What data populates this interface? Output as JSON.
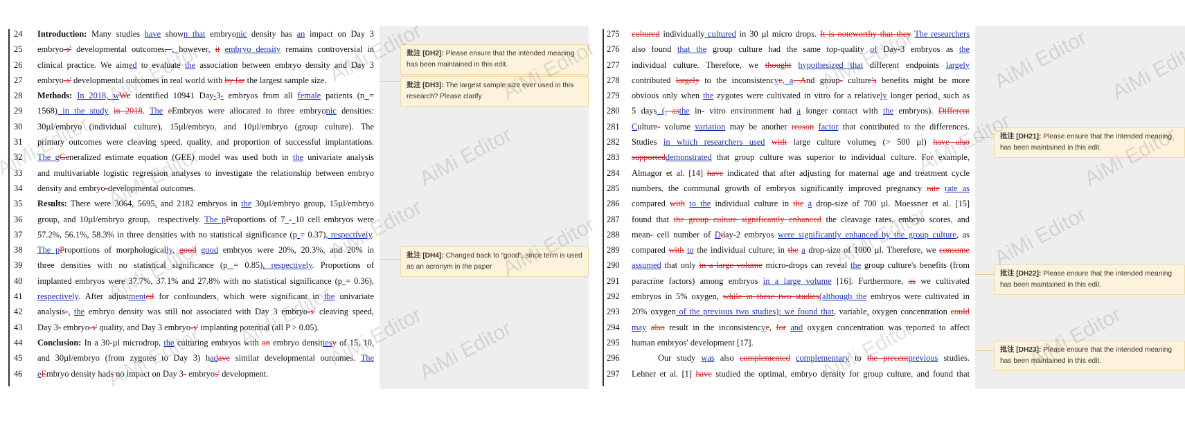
{
  "watermark": "AiMi Editor",
  "left_page": {
    "lines": [
      {
        "n": "24",
        "html": "<b>Introduction:</b> Many studies <span class=\"ins\">have</span> show<span class=\"ins\">n that</span> embryo<span class=\"ins\">nic</span> density has <span class=\"ins\">an</span> impact on Day 3"
      },
      {
        "n": "25",
        "html": "embryo<span class=\"del\">-s'</span> developmental outcomes<span class=\"del\">, </span><span class=\"ins\">; </span>however<span class=\"ins\">,</span> <span class=\"del\">it</span> <span class=\"ins\">embryo density</span> remains controversial in"
      },
      {
        "n": "26",
        "html": "clinical practice. We aim<span class=\"ins\">ed</span> to evaluate <span class=\"ins\">the</span> association between embryo density and Day 3"
      },
      {
        "n": "27",
        "html": "embryo<span class=\"del\">-s'</span> developmental outcomes in real world with <span class=\"del\">by far</span> the largest sample size.",
        "last": true
      },
      {
        "n": "28",
        "html": "<b>Methods:</b> <span class=\"ins\">In 2018, w</span><span class=\"del\">W</span>e identified 10941 Day<span class=\"ins\">-</span>3<span class=\"ins\">-</span> embryos from all <span class=\"ins\">female</span> patients (n<span class=\"ins\"> </span>="
      },
      {
        "n": "29",
        "html": "1568)<span class=\"ins\"> in the study</span> <span class=\"del\">in 2018</span>. <span class=\"ins\">The</span> <span class=\"del\">e</span>Embryos were allocated to three embryo<span class=\"ins\">nic</span> densities:"
      },
      {
        "n": "30",
        "html": "30µl/embryo (individual culture), 15µl/embryo<span class=\"ins\">,</span> and 10µl/embryo (group culture). The"
      },
      {
        "n": "31",
        "html": "primary outcomes were cleaving speed, quality<span class=\"ins\">,</span> and proportion of successful implantations."
      },
      {
        "n": "32",
        "html": "<span class=\"ins\">The g</span><span class=\"del\">G</span>eneralized estimate equation (GEE) model was used both in <span class=\"ins\">the</span> univariate analysis"
      },
      {
        "n": "33",
        "html": "and multivariable logistic regression analyses to investigate the relationship between embryo"
      },
      {
        "n": "34",
        "html": "density and embryo<span class=\"del\">-</span>developmental outcomes.",
        "last": true
      },
      {
        "n": "35",
        "html": "<b>Results:</b> There were 3064, 5695<span class=\"ins\">,</span> and 2182 embryos in <span class=\"ins\">the</span> 30µl/embryo group, 15µl/embryo"
      },
      {
        "n": "36",
        "html": "group<span class=\"ins\">,</span> and 10µl/embryo group, &nbsp;respectively. <span class=\"ins\">The p</span><span class=\"del\">P</span>roportions of 7<span class=\"ins\"> </span>-<span class=\"ins\"> </span>10 cell embryos were"
      },
      {
        "n": "37",
        "html": "57.2%, 56.1%, 58.3% in three densities with no statistical significance (p<span class=\"ins\"> </span>= 0.37)<span class=\"ins\">, respectively</span>."
      },
      {
        "n": "38",
        "html": "<span class=\"ins\">The p</span><span class=\"del\">P</span>roportions of morphological<span class=\"ins\">ly,</span> <span class=\"del\">good</span> <span class=\"ins\">good</span> embryos were 20%, 20.3%<span class=\"ins\">,</span> and 20% in"
      },
      {
        "n": "39",
        "html": "three densities with no statistical significance (p<span class=\"ins\"> </span>= 0.85)<span class=\"ins\">, respectively</span>. Proportions of"
      },
      {
        "n": "40",
        "html": "implanted embryos were 37.7%, 37.1% and 27.8% with no statistical significance (p<span class=\"ins\"> </span>= 0.36)<span class=\"ins\">,</span>"
      },
      {
        "n": "41",
        "html": "<span class=\"ins\">respectively</span>. After adjust<span class=\"ins\">ment</span><span class=\"del\">ed</span> for confounders<span class=\"ins\">,</span> which were significant in <span class=\"ins\">the</span> univariate"
      },
      {
        "n": "42",
        "html": "analysis<span class=\"del\">-</span><span class=\"ins\">,</span> <span class=\"ins\">the</span> embryo density was still not associated with Day 3 embryo<span class=\"del\">-s'</span> cleaving speed,"
      },
      {
        "n": "43",
        "html": "Day 3<span class=\"del\">-</span> embryo<span class=\"del\">-s'</span> quality<span class=\"ins\">,</span> and Day 3 embryo<span class=\"del\">-s'</span> implanting potential (all P &gt; 0.05).",
        "last": true
      },
      {
        "n": "44",
        "html": "<b>Conclusion:</b> In a 30-µl microdrop, <span class=\"ins\">the</span> culturing embryos with <span class=\"del\">an</span> embryo densit<span class=\"ins\">ies</span><span class=\"del\">y</span> of 15, 10<span class=\"ins\">,</span>"
      },
      {
        "n": "45",
        "html": "and 30µl/embryo (from zygotes to Day 3) h<span class=\"ins\">ad</span><span class=\"del\">ave</span> similar developmental outcomes. <span class=\"ins\">The</span>"
      },
      {
        "n": "46",
        "html": "<span class=\"ins\">e</span><span class=\"del\">E</span>mbryo density had<span class=\"del\">s</span> no impact on Day 3<span class=\"del\">-</span> embryo<span class=\"del\">s'</span> development.",
        "last": true
      }
    ]
  },
  "right_page": {
    "lines": [
      {
        "n": "275",
        "html": "<span class=\"del\">cultured</span> individually<span class=\"ins\"> cultured</span> in 30 µl micro drops. <span class=\"del\">It is noteworthy that they</span> <span class=\"ins\">The researchers</span>"
      },
      {
        "n": "276",
        "html": "also found <span class=\"ins\">that the</span> group culture had the same top-quality <span class=\"ins\">of</span> Day<span class=\"del\">-</span>3 embryos as <span class=\"ins\">the</span>"
      },
      {
        "n": "277",
        "html": "individual culture. Therefore, we <span class=\"del\">thought</span> <span class=\"ins\">hypothesized that</span> different endpoints <span class=\"ins\">largely</span>"
      },
      {
        "n": "278",
        "html": "contributed <span class=\"del\">largely</span> to the inconsistenc<span class=\"ins\">y</span><span class=\"del\">e</span><span class=\"ins\">, a</span><span class=\"del\">. A</span>nd group<span class=\"del\">-</span> culture<span class=\"del\">'s</span> benefits might be more"
      },
      {
        "n": "279",
        "html": "obvious only when <span class=\"ins\">the</span> zygotes were cultivated in vitro for a relative<span class=\"ins\">ly</span> longer period<span class=\"ins\">,</span> such as"
      },
      {
        "n": "280",
        "html": "5 days<span class=\"ins\"> (</span><span class=\"del\">, as</span><span class=\"ins\">the</span> in<span class=\"del\">-</span> vitro environment had <span class=\"ins\">a</span> longer contact with <span class=\"ins\">the</span> embryos). <span class=\"del\">Different</span>"
      },
      {
        "n": "281",
        "html": "<span class=\"ins\">C</span>ulture<span class=\"del\">-</span> volume <span class=\"ins\">variation</span> may be another <span class=\"del\">reason</span> <span class=\"ins\">factor</span> that contributed to the differences."
      },
      {
        "n": "282",
        "html": "Studies <span class=\"ins\">in which researchers used</span> <span class=\"del\">with</span> large culture volume<span class=\"ins\">s</span> (&gt; 500 µl) <span class=\"del\">have also</span>"
      },
      {
        "n": "283",
        "html": "<span class=\"del\">supported</span><span class=\"ins\">demonstrated</span> that group culture was superior to individual culture. For example,"
      },
      {
        "n": "284",
        "html": "Almagor et al. [14] <span class=\"del\">have</span> indicated that after adjusting for maternal age and treatment cycle"
      },
      {
        "n": "285",
        "html": "numbers, the communal growth of embryos significantly improved pregnancy <span class=\"del\">rate</span> <span class=\"ins\">rate as</span>"
      },
      {
        "n": "286",
        "html": "compared <span class=\"del\">with</span> <span class=\"ins\">to the</span> individual culture in <span class=\"del\">the</span> <span class=\"ins\">a</span> drop-size of 700 µl. Moessner et al. [15]"
      },
      {
        "n": "287",
        "html": "found that <span class=\"del\">the group culture significantly enhanced</span> the cleavage rates, embryo scores<span class=\"ins\">,</span> and"
      },
      {
        "n": "288",
        "html": "mean<span class=\"del\">-</span> cell number of <span class=\"ins\">D</span><span class=\"del\">d</span>ay<span class=\"del\">-</span>2 embryos <span class=\"ins\">were significantly enhanced by the group culture</span>, as"
      },
      {
        "n": "289",
        "html": "compared <span class=\"del\">with</span> <span class=\"ins\">to</span> the individual culture<span class=\"ins\">;</span> in <span class=\"del\">the</span> <span class=\"ins\">a</span> drop-size of 1000 µl. Therefore, we <span class=\"del\">consume</span>"
      },
      {
        "n": "290",
        "html": "<span class=\"ins\">assumed</span> that only <span class=\"del\">in a large volume</span> micro<span class=\"del\">-</span>drops can reveal <span class=\"ins\">the</span> group culture's benefits (from"
      },
      {
        "n": "291",
        "html": "paracrine factors) among embryos <span class=\"ins\">in a large volume</span> [16]. Furthermore, <span class=\"del\">as</span> we cultivated"
      },
      {
        "n": "292",
        "html": "embryos in 5% oxygen, <span class=\"del\">while in these two studies</span><span class=\"ins\">(although the</span> embryos were cultivated in"
      },
      {
        "n": "293",
        "html": "20% oxygen<span class=\"ins\"> of the previous two studies); we found that</span>, variable<span class=\"ins\">,</span> oxygen concentration <span class=\"del\">could</span>"
      },
      {
        "n": "294",
        "html": "<span class=\"ins\">may</span> <span class=\"del\">also</span> result in the inconsistenc<span class=\"ins\">y</span><span class=\"del\">e</span>, <span class=\"del\">for</span> <span class=\"ins\">and</span> oxygen concentration was reported to affect"
      },
      {
        "n": "295",
        "html": "human embryos' development [17].",
        "last": true
      },
      {
        "n": "296",
        "html": "Our study <span class=\"ins\">was</span> also <span class=\"del\">complemented</span> <span class=\"ins\">complementary</span> to <span class=\"del\">the precent</span><span class=\"ins\">previous</span> studies.",
        "indent": true
      },
      {
        "n": "297",
        "html": "Lehner et al. [1] <span class=\"del\">have</span> studied the optimal<span class=\"ins\">,</span> embryo density for group culture<span class=\"ins\">,</span> and found that"
      }
    ]
  },
  "comments": [
    {
      "id": "DH2",
      "label": "批注 [DH2]:",
      "text": "Please ensure that the intended meaning has been maintained in this edit."
    },
    {
      "id": "DH3",
      "label": "批注 [DH3]:",
      "text": "The largest sample size ever used in this research? Please clarify"
    },
    {
      "id": "DH4",
      "label": "批注 [DH4]:",
      "text": "Changed back to “good”, since term is used as an acronym in the paper"
    },
    {
      "id": "DH21",
      "label": "批注 [DH21]:",
      "text": "Please ensure that the intended meaning has been maintained in this edit."
    },
    {
      "id": "DH22",
      "label": "批注 [DH22]:",
      "text": "Please ensure that the intended meaning has been maintained in this edit."
    },
    {
      "id": "DH23",
      "label": "批注 [DH23]:",
      "text": "Please ensure that the intended meaning has been maintained in this edit."
    }
  ]
}
